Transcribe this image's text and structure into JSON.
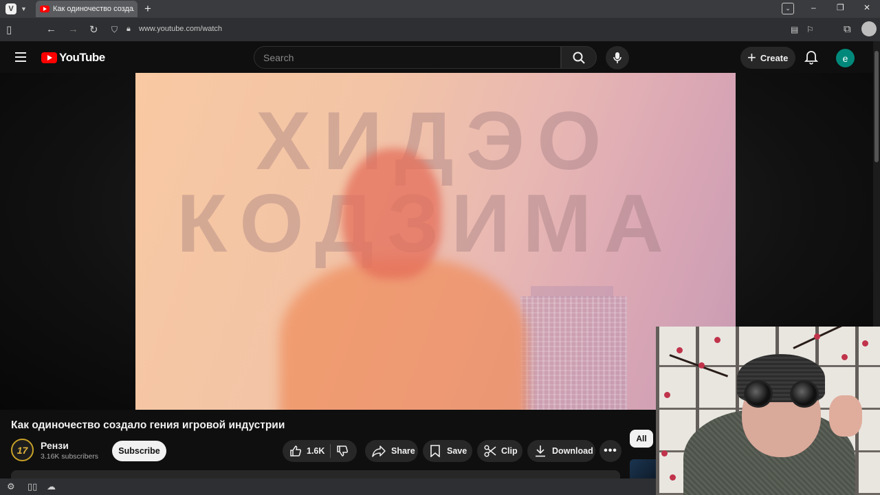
{
  "browser": {
    "tab_title": "Как одиночество создало",
    "url": "www.youtube.com/watch",
    "icons": [
      "vivaldi-logo",
      "panel-toggle-icon",
      "back-icon",
      "forward-icon",
      "reload-icon",
      "shield-icon",
      "lock-icon",
      "reader-icon",
      "bookmark-icon",
      "extensions-icon",
      "profile-icon",
      "minimize-icon",
      "maximize-icon",
      "close-icon"
    ]
  },
  "youtube": {
    "logo_text": "YouTube",
    "search_placeholder": "Search",
    "create_label": "Create",
    "avatar_letter": "e"
  },
  "video": {
    "frame_text_line1": "ХИДЭО",
    "frame_text_line2": "КОДЗИМА",
    "title": "Как одиночество создало гения игровой индустрии",
    "channel": {
      "name": "Рензи",
      "subscribers": "3.16K subscribers",
      "avatar_text": "17"
    },
    "subscribe_label": "Subscribe",
    "actions": {
      "like_count": "1.6K",
      "share": "Share",
      "save": "Save",
      "clip": "Clip",
      "download": "Download"
    },
    "chip_all": "All"
  },
  "colors": {
    "yt_red": "#ff0000",
    "background": "#0f0f0f",
    "avatar": "#00897b"
  }
}
